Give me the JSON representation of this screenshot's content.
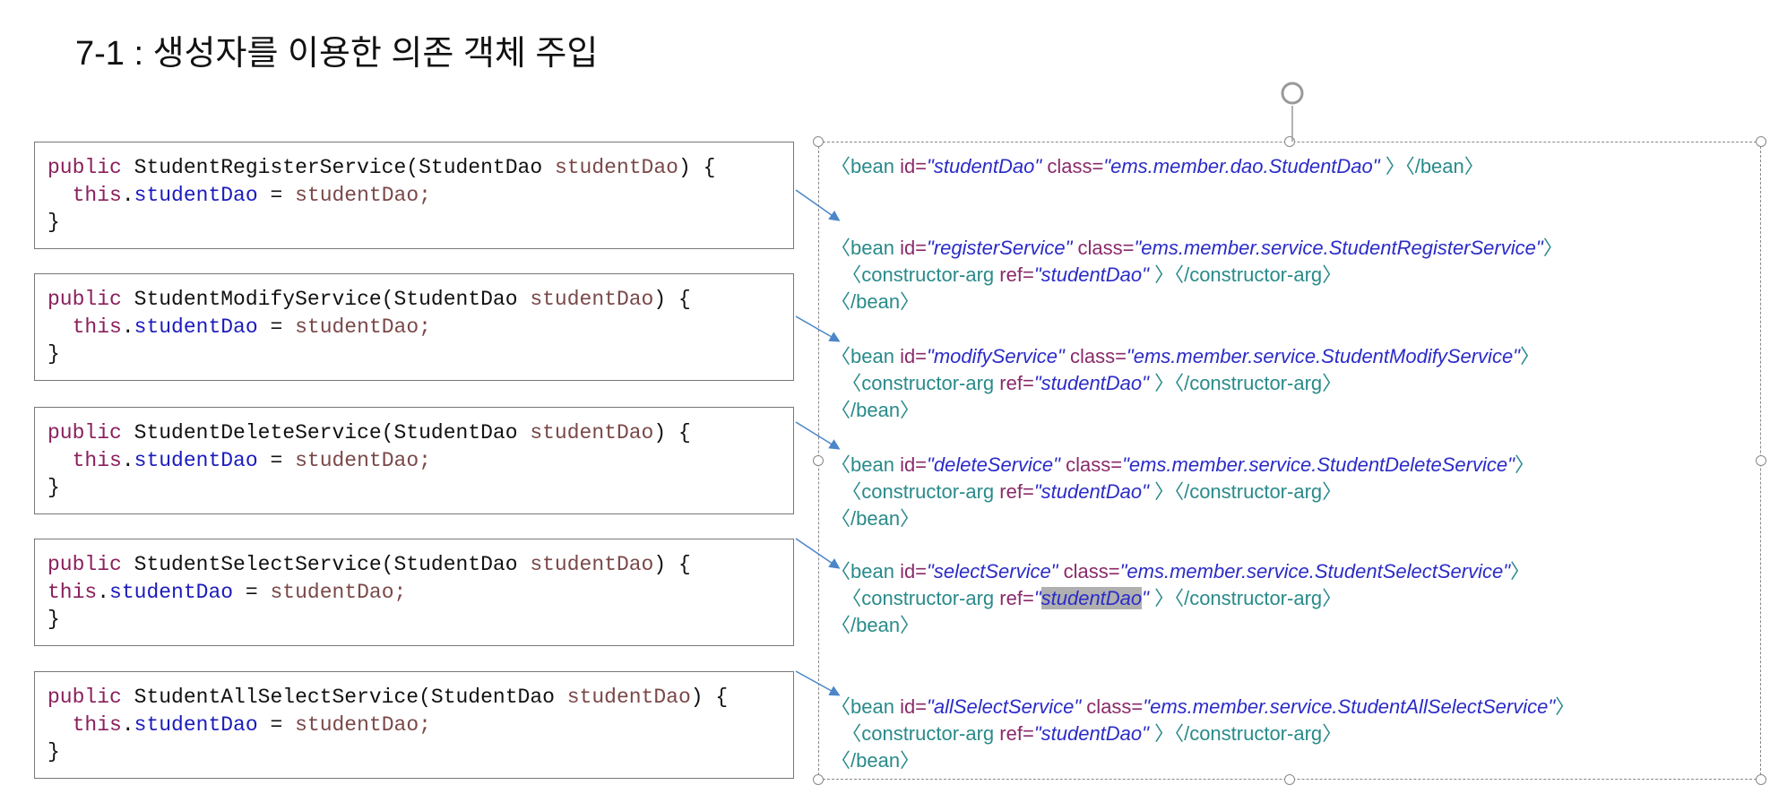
{
  "title": "7-1 : 생성자를 이용한 의존 객체 주입",
  "java": [
    {
      "kw": "public",
      "name": "StudentRegisterService(StudentDao",
      "param": "studentDao",
      "end": ") {",
      "this": "this",
      "dot": ".",
      "field": "studentDao",
      "assign": " = ",
      "rhs": "studentDao;",
      "close": "}"
    },
    {
      "kw": "public",
      "name": "StudentModifyService(StudentDao",
      "param": "studentDao",
      "end": ") {",
      "this": "this",
      "dot": ".",
      "field": "studentDao",
      "assign": " = ",
      "rhs": "studentDao;",
      "close": "}"
    },
    {
      "kw": "public",
      "name": "StudentDeleteService(StudentDao",
      "param": "studentDao",
      "end": ") {",
      "this": "this",
      "dot": ".",
      "field": "studentDao",
      "assign": " = ",
      "rhs": "studentDao;",
      "close": "}"
    },
    {
      "kw": "public",
      "name": "StudentSelectService(StudentDao",
      "param": "studentDao",
      "end": ") {",
      "this": "this",
      "dot": ".",
      "field": "studentDao",
      "assign": " = ",
      "rhs": "studentDao;",
      "close": "}"
    },
    {
      "kw": "public",
      "name": "StudentAllSelectService(StudentDao",
      "param": "studentDao",
      "end": ") {",
      "this": "this",
      "dot": ".",
      "field": "studentDao",
      "assign": " = ",
      "rhs": "studentDao;",
      "close": "}"
    }
  ],
  "xml": {
    "dao": {
      "open": "〈bean ",
      "id": "id=",
      "idv": "\"studentDao\"",
      "cls": " class=",
      "clsv": "\"ems.member.dao.StudentDao\"",
      "end": " 〉〈/bean〉"
    },
    "beans": [
      {
        "id": "\"registerService\"",
        "cls": "\"ems.member.service.StudentRegisterService\""
      },
      {
        "id": "\"modifyService\"",
        "cls": "\"ems.member.service.StudentModifyService\""
      },
      {
        "id": "\"deleteService\"",
        "cls": "\"ems.member.service.StudentDeleteService\""
      },
      {
        "id": "\"selectService\"",
        "cls": "\"ems.member.service.StudentSelectService\""
      },
      {
        "id": "\"allSelectService\"",
        "cls": "\"ems.member.service.StudentAllSelectService\""
      }
    ],
    "bean_open": "〈bean ",
    "id_attr": "id=",
    "class_attr": " class=",
    "gt": "〉",
    "carg_open": "  〈constructor-arg ",
    "ref_attr": "ref=",
    "q": "\"",
    "ref_val": "studentDao",
    "carg_end": " 〉〈/constructor-arg〉",
    "bean_close": "〈/bean〉"
  }
}
